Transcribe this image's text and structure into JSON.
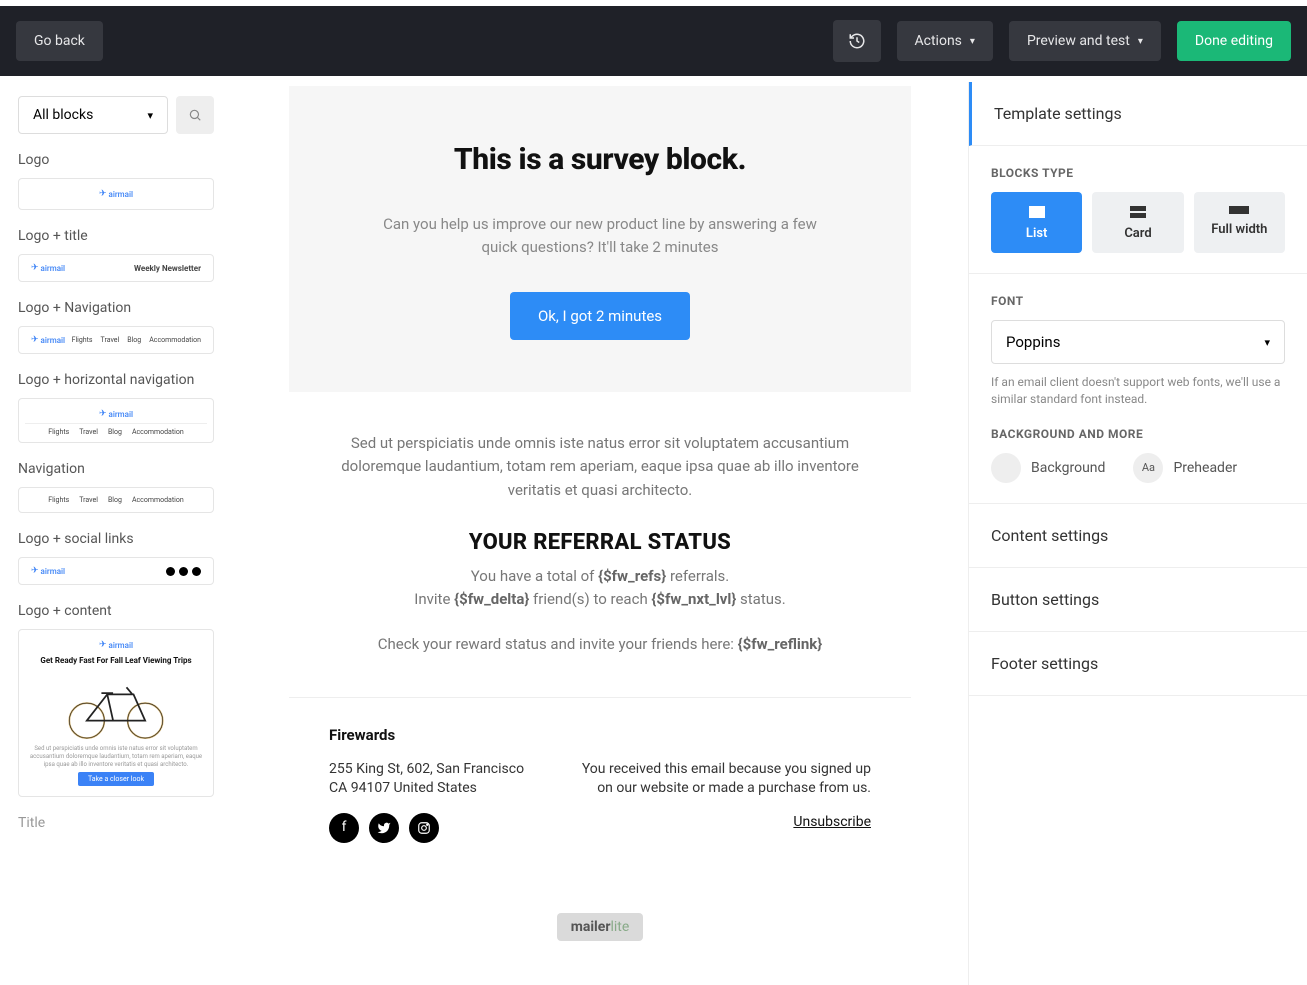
{
  "topbar": {
    "go_back": "Go back",
    "actions": "Actions",
    "preview": "Preview and test",
    "done": "Done editing"
  },
  "sidebar": {
    "dropdown": "All blocks",
    "blocks": [
      {
        "label": "Logo",
        "type": "logo"
      },
      {
        "label": "Logo + title",
        "type": "logo_title",
        "title": "Weekly Newsletter"
      },
      {
        "label": "Logo + Navigation",
        "type": "logo_nav",
        "nav": [
          "Flights",
          "Travel",
          "Blog",
          "Accommodation"
        ]
      },
      {
        "label": "Logo + horizontal navigation",
        "type": "logo_hnav",
        "nav": [
          "Flights",
          "Travel",
          "Blog",
          "Accommodation"
        ]
      },
      {
        "label": "Navigation",
        "type": "nav",
        "nav": [
          "Flights",
          "Travel",
          "Blog",
          "Accommodation"
        ]
      },
      {
        "label": "Logo + social links",
        "type": "logo_social"
      },
      {
        "label": "Logo + content",
        "type": "logo_content",
        "title": "Get Ready Fast For Fall Leaf Viewing Trips",
        "body": "Sed ut perspiciatis unde omnis iste natus error sit voluptatem accusantium doloremque laudantium, totam rem aperiam, eaque ipsa quae ab illo inventore veritatis et quasi architecto.",
        "cta": "Take a closer look"
      },
      {
        "label": "Title",
        "type": "title"
      }
    ]
  },
  "canvas": {
    "survey": {
      "title": "This is a survey block.",
      "desc": "Can you help us improve our new product line by answering a few quick questions? It'll take 2 minutes",
      "cta": "Ok, I got 2 minutes"
    },
    "lorem": "Sed ut perspiciatis unde omnis iste natus error sit voluptatem accusantium doloremque laudantium, totam rem aperiam, eaque ipsa quae ab illo inventore veritatis et quasi architecto.",
    "referral": {
      "heading": "YOUR REFERRAL STATUS",
      "l1_a": "You have a total of ",
      "l1_b": "{$fw_refs}",
      "l1_c": " referrals.",
      "l2_a": "Invite ",
      "l2_b": "{$fw_delta}",
      "l2_c": " friend(s) to reach ",
      "l2_d": "{$fw_nxt_lvl}",
      "l2_e": " status.",
      "l3_a": "Check your reward status and invite your friends here: ",
      "l3_b": "{$fw_reflink}"
    },
    "footer": {
      "company": "Firewards",
      "addr1": "255 King St, 602, San Francisco",
      "addr2": "CA 94107 United States",
      "reason": "You received this email because you signed up on our website or made a purchase from us.",
      "unsubscribe": "Unsubscribe"
    },
    "brand": "mailerlite"
  },
  "settings": {
    "template": "Template settings",
    "btype_label": "BLOCKS TYPE",
    "btype": [
      {
        "label": "List",
        "active": true
      },
      {
        "label": "Card",
        "active": false
      },
      {
        "label": "Full width",
        "active": false
      }
    ],
    "font_label": "FONT",
    "font_value": "Poppins",
    "font_hint": "If an email client doesn't support web fonts, we'll use a similar standard font instead.",
    "bg_label": "BACKGROUND AND MORE",
    "bg": "Background",
    "preheader": "Preheader",
    "content": "Content settings",
    "button": "Button settings",
    "footer": "Footer settings"
  }
}
